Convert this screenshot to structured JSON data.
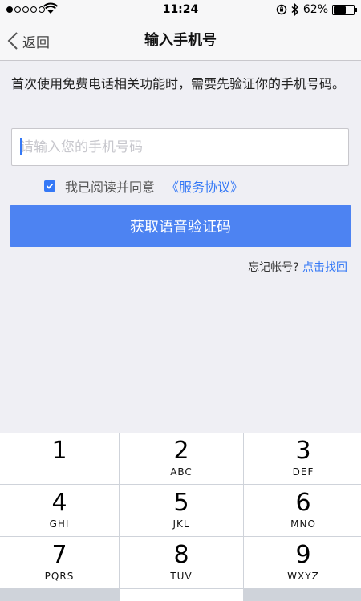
{
  "status_bar": {
    "time": "11:24",
    "battery_text": "62%",
    "battery_level": 0.62,
    "signal_bars": 1
  },
  "nav": {
    "back_label": "返回",
    "title": "输入手机号"
  },
  "content": {
    "description": "首次使用免费电话相关功能时，需要先验证你的手机号码。",
    "phone_placeholder": "请输入您的手机号码",
    "phone_value": "",
    "agree_checked": true,
    "agree_text": "我已阅读并同意",
    "terms_link": "《服务协议》",
    "submit_label": "获取语音验证码",
    "forgot_text": "忘记帐号?",
    "forgot_link": "点击找回"
  },
  "keypad": {
    "keys": [
      {
        "num": "1",
        "letters": ""
      },
      {
        "num": "2",
        "letters": "ABC"
      },
      {
        "num": "3",
        "letters": "DEF"
      },
      {
        "num": "4",
        "letters": "GHI"
      },
      {
        "num": "5",
        "letters": "JKL"
      },
      {
        "num": "6",
        "letters": "MNO"
      },
      {
        "num": "7",
        "letters": "PQRS"
      },
      {
        "num": "8",
        "letters": "TUV"
      },
      {
        "num": "9",
        "letters": "WXYZ"
      }
    ]
  },
  "colors": {
    "accent": "#3478f6",
    "button": "#4d83f2",
    "background": "#efeff4"
  }
}
